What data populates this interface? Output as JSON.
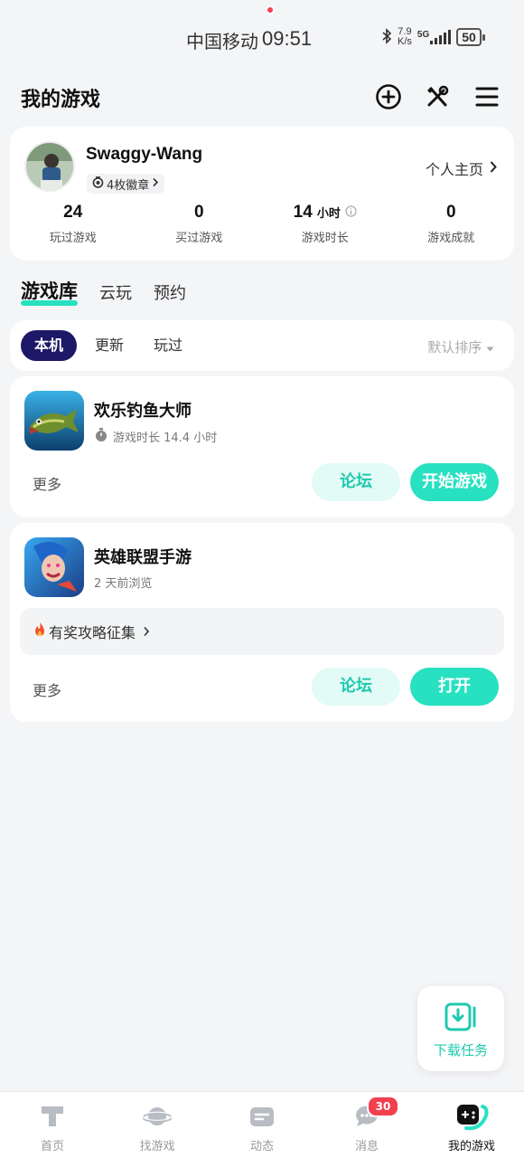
{
  "status_bar": {
    "carrier": "中国移动",
    "time": "09:51",
    "net_speed_value": "7.9",
    "net_speed_unit": "K/s",
    "network": "5G",
    "battery": "50",
    "icons": [
      "bluetooth-icon",
      "signal-icon",
      "battery-icon"
    ]
  },
  "header": {
    "title": "我的游戏",
    "icons": [
      "add-circle-icon",
      "tools-icon",
      "menu-icon"
    ]
  },
  "profile": {
    "username": "Swaggy-Wang",
    "badge_text": "4枚徽章",
    "profile_link": "个人主页",
    "stats": [
      {
        "value": "24",
        "unit": "",
        "label": "玩过游戏"
      },
      {
        "value": "0",
        "unit": "",
        "label": "买过游戏"
      },
      {
        "value": "14",
        "unit": "小时",
        "label": "游戏时长"
      },
      {
        "value": "0",
        "unit": "",
        "label": "游戏成就"
      }
    ]
  },
  "tabs": [
    {
      "label": "游戏库",
      "active": true
    },
    {
      "label": "云玩",
      "active": false
    },
    {
      "label": "预约",
      "active": false
    }
  ],
  "filters": {
    "chips": [
      {
        "label": "本机",
        "active": true
      },
      {
        "label": "更新",
        "active": false
      },
      {
        "label": "玩过",
        "active": false
      }
    ],
    "sort_label": "默认排序"
  },
  "games": [
    {
      "name": "欢乐钓鱼大师",
      "meta": "游戏时长 14.4 小时",
      "more": "更多",
      "forum_label": "论坛",
      "action_label": "开始游戏"
    },
    {
      "name": "英雄联盟手游",
      "meta": "2 天前浏览",
      "promo": "有奖攻略征集",
      "more": "更多",
      "forum_label": "论坛",
      "action_label": "打开"
    }
  ],
  "download_float": {
    "label": "下载任务"
  },
  "bottom_nav": [
    {
      "label": "首页",
      "icon": "home-icon"
    },
    {
      "label": "找游戏",
      "icon": "planet-icon"
    },
    {
      "label": "动态",
      "icon": "feed-icon"
    },
    {
      "label": "消息",
      "icon": "message-icon",
      "badge": "30"
    },
    {
      "label": "我的游戏",
      "icon": "gamepad-icon",
      "active": true
    }
  ],
  "colors": {
    "accent": "#27e1c1",
    "accent_dark": "#1fc9ae",
    "chip_active": "#1d1868",
    "badge_red": "#f2404f",
    "background": "#f4f5f7"
  }
}
